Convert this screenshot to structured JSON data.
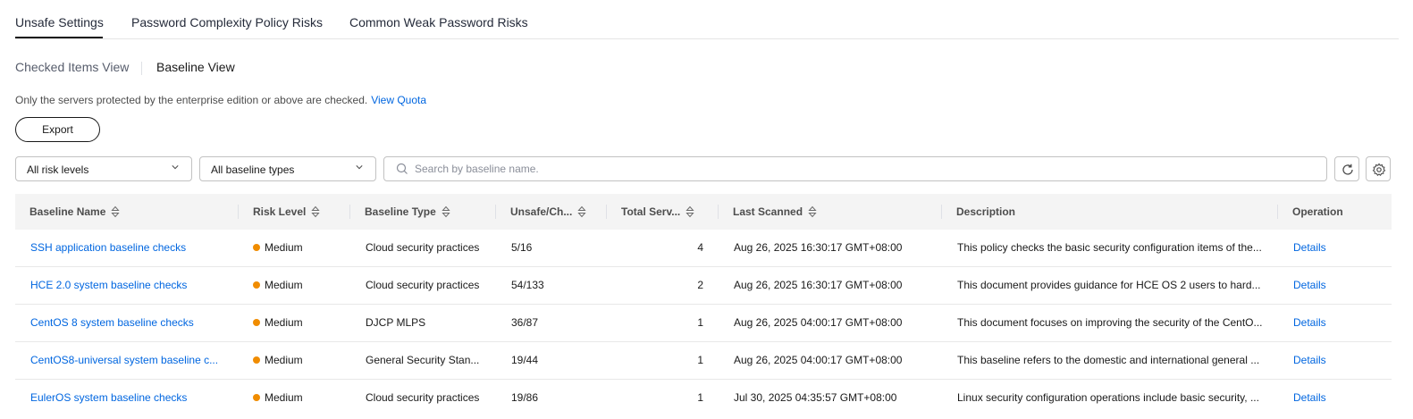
{
  "tabs": [
    {
      "label": "Unsafe Settings",
      "active": true
    },
    {
      "label": "Password Complexity Policy Risks",
      "active": false
    },
    {
      "label": "Common Weak Password Risks",
      "active": false
    }
  ],
  "views": [
    {
      "label": "Checked Items View",
      "active": false
    },
    {
      "label": "Baseline View",
      "active": true
    }
  ],
  "notice": {
    "text": "Only the servers protected by the enterprise edition or above are checked.",
    "link": "View Quota"
  },
  "export_label": "Export",
  "filters": {
    "risk_level": "All risk levels",
    "baseline_type": "All baseline types",
    "search_placeholder": "Search by baseline name."
  },
  "colors": {
    "link": "#0066e0",
    "medium": "#f08c00"
  },
  "table": {
    "headers": {
      "name": "Baseline Name",
      "risk": "Risk Level",
      "type": "Baseline Type",
      "unsafe": "Unsafe/Ch...",
      "total": "Total Serv...",
      "scanned": "Last Scanned",
      "desc": "Description",
      "op": "Operation"
    },
    "rows": [
      {
        "name": "SSH application baseline checks",
        "risk": "Medium",
        "type": "Cloud security practices",
        "unsafe": "5/16",
        "total": "4",
        "scanned": "Aug 26, 2025 16:30:17 GMT+08:00",
        "desc": "This policy checks the basic security configuration items of the...",
        "op": "Details"
      },
      {
        "name": "HCE 2.0 system baseline checks",
        "risk": "Medium",
        "type": "Cloud security practices",
        "unsafe": "54/133",
        "total": "2",
        "scanned": "Aug 26, 2025 16:30:17 GMT+08:00",
        "desc": "This document provides guidance for HCE OS 2 users to hard...",
        "op": "Details"
      },
      {
        "name": "CentOS 8 system baseline checks",
        "risk": "Medium",
        "type": "DJCP MLPS",
        "unsafe": "36/87",
        "total": "1",
        "scanned": "Aug 26, 2025 04:00:17 GMT+08:00",
        "desc": "This document focuses on improving the security of the CentO...",
        "op": "Details"
      },
      {
        "name": "CentOS8-universal system baseline c...",
        "risk": "Medium",
        "type": "General Security Stan...",
        "unsafe": "19/44",
        "total": "1",
        "scanned": "Aug 26, 2025 04:00:17 GMT+08:00",
        "desc": "This baseline refers to the domestic and international general ...",
        "op": "Details"
      },
      {
        "name": "EulerOS system baseline checks",
        "risk": "Medium",
        "type": "Cloud security practices",
        "unsafe": "19/86",
        "total": "1",
        "scanned": "Jul 30, 2025 04:35:57 GMT+08:00",
        "desc": "Linux security configuration operations include basic security, ...",
        "op": "Details"
      }
    ]
  }
}
